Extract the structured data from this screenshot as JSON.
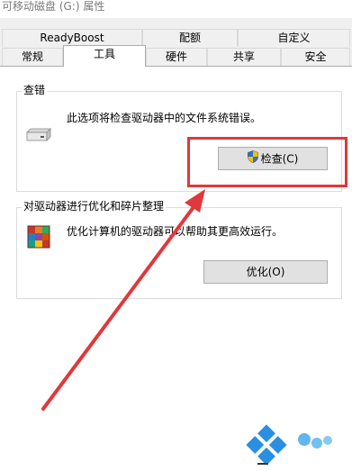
{
  "window": {
    "title": "可移动磁盘 (G:) 属性"
  },
  "tabs_back": [
    {
      "label": "ReadyBoost"
    },
    {
      "label": "配额"
    },
    {
      "label": "自定义"
    }
  ],
  "tabs_front": [
    {
      "label": "常规"
    },
    {
      "label": "工具"
    },
    {
      "label": "硬件"
    },
    {
      "label": "共享"
    },
    {
      "label": "安全"
    }
  ],
  "active_tab": "工具",
  "error_checking": {
    "title": "查错",
    "description": "此选项将检查驱动器中的文件系统错误。",
    "button_label": "检查(C)",
    "drive_icon": "drive-icon",
    "shield_icon": "uac-shield-icon"
  },
  "optimize": {
    "title": "对驱动器进行优化和碎片整理",
    "description": "优化计算机的驱动器可以帮助其更高效运行。",
    "button_label": "优化(O)",
    "icon": "defrag-icon"
  },
  "annotation": {
    "highlight_color": "#e0383b",
    "arrow_color": "#e0383b"
  }
}
